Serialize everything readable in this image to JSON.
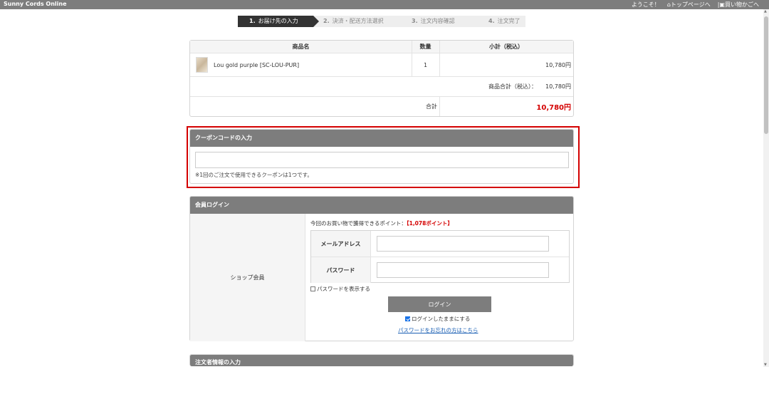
{
  "topbar": {
    "shop_name": "Sunny Cords Online",
    "welcome": "ようこそ！",
    "top_link": "トップページへ",
    "cart_link": "買い物かごへ"
  },
  "steps": [
    {
      "num": "1.",
      "label": "お届け先の入力",
      "active": true
    },
    {
      "num": "2.",
      "label": "決済・配送方法選択",
      "active": false
    },
    {
      "num": "3.",
      "label": "注文内容確認",
      "active": false
    },
    {
      "num": "4.",
      "label": "注文完了",
      "active": false
    }
  ],
  "cart": {
    "headers": {
      "product": "商品名",
      "qty": "数量",
      "subtotal": "小計（税込）"
    },
    "item": {
      "name": "Lou gold purple [SC-LOU-PUR]",
      "qty": "1",
      "price": "10,780円"
    },
    "product_total_label": "商品合計（税込）：",
    "product_total_value": "10,780円",
    "grand_total_label": "合計",
    "grand_total_value": "10,780円"
  },
  "coupon": {
    "title": "クーポンコードの入力",
    "input_value": "",
    "note": "※1回のご注文で使用できるクーポンは1つです。"
  },
  "member": {
    "title": "会員ログイン",
    "left_label": "ショップ会員",
    "points_prefix": "今回のお買い物で獲得できるポイント：",
    "points_value": "【1,078ポイント】",
    "email_label": "メールアドレス",
    "email_value": "",
    "password_label": "パスワード",
    "password_value": "",
    "show_password": "パスワードを表示する",
    "login_button": "ログイン",
    "keep_logged_in": "ログインしたままにする",
    "forgot": "パスワードをお忘れの方はこちら"
  },
  "orderer": {
    "title": "注文者情報の入力"
  }
}
